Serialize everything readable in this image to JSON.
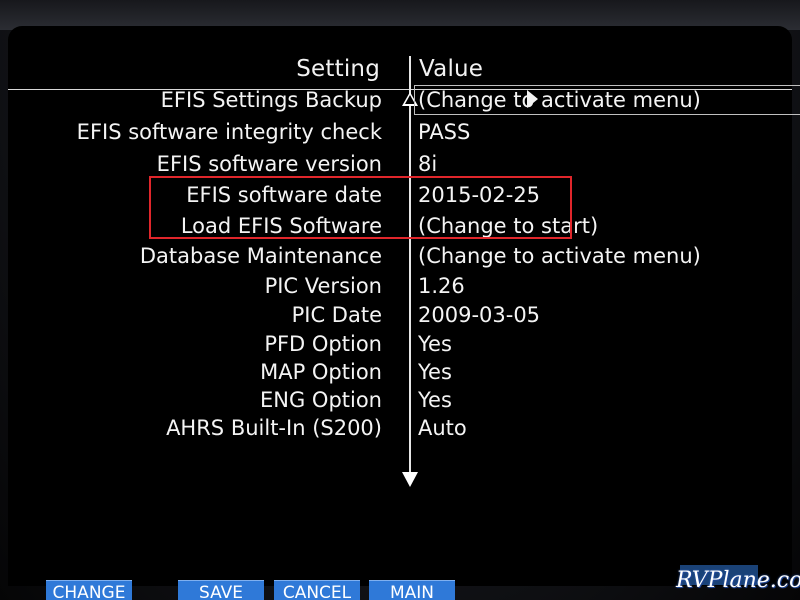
{
  "header": {
    "setting_label": "Setting",
    "value_label": "Value"
  },
  "rows": [
    {
      "setting": "EFIS Settings Backup",
      "value": "(Change to activate menu)",
      "selected": true,
      "submenu": true
    },
    {
      "setting": "EFIS software integrity check",
      "value": "PASS"
    },
    {
      "setting": "EFIS software version",
      "value": "8i",
      "highlighted": true
    },
    {
      "setting": "EFIS software date",
      "value": "2015-02-25",
      "highlighted": true
    },
    {
      "setting": "Load EFIS Software",
      "value": "(Change to start)"
    },
    {
      "setting": "Database Maintenance",
      "value": "(Change to activate menu)"
    },
    {
      "setting": "PIC Version",
      "value": "1.26"
    },
    {
      "setting": "PIC Date",
      "value": "2009-03-05"
    },
    {
      "setting": "PFD Option",
      "value": "Yes"
    },
    {
      "setting": "MAP Option",
      "value": "Yes"
    },
    {
      "setting": "ENG Option",
      "value": "Yes"
    },
    {
      "setting": "AHRS Built-In (S200)",
      "value": "Auto"
    }
  ],
  "softkeys": {
    "change": "CHANGE",
    "save": "SAVE",
    "cancel": "CANCEL",
    "main": "MAIN"
  },
  "watermark": "RVPlane.com",
  "colors": {
    "highlight_border": "#e0262b",
    "softkey_bg": "#2f79d8",
    "text": "#f4f4f4"
  }
}
